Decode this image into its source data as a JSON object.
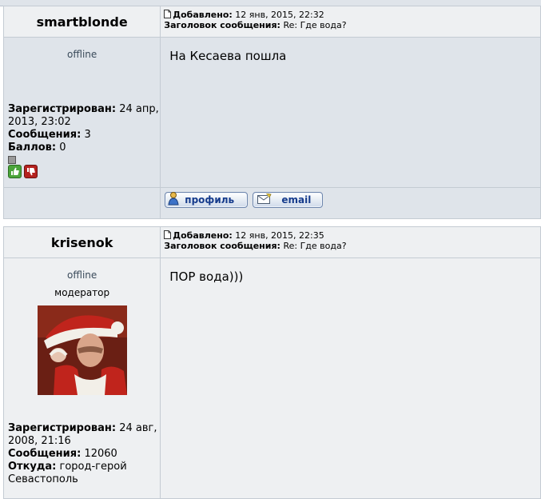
{
  "posts": [
    {
      "username": "smartblonde",
      "status": "offline",
      "added_label": "Добавлено:",
      "added_date": "12 янв, 2015, 22:32",
      "subject_label": "Заголовок сообщения:",
      "subject": "Re: Где вода?",
      "body": "На Кесаева пошла",
      "registered_label": "Зарегистрирован:",
      "registered_line1": "24 апр,",
      "registered_line2": "2013, 23:02",
      "messages_label": "Сообщения:",
      "messages": "3",
      "points_label": "Баллов:",
      "points": "0",
      "profile_button": "профиль",
      "email_button": "email"
    },
    {
      "username": "krisenok",
      "status": "offline",
      "rank": "модератор",
      "added_label": "Добавлено:",
      "added_date": "12 янв, 2015, 22:35",
      "subject_label": "Заголовок сообщения:",
      "subject": "Re: Где вода?",
      "body": "ПОР вода)))",
      "registered_label": "Зарегистрирован:",
      "registered_line1": "24 авг,",
      "registered_line2": "2008, 21:16",
      "messages_label": "Сообщения:",
      "messages": "12060",
      "from_label": "Откуда:",
      "from_line1": "город-герой",
      "from_line2": "Севастополь"
    }
  ],
  "colors": {
    "row_light": "#eef0f2",
    "row_dark": "#dfe4ea",
    "border": "#c4cbd3",
    "button_text": "#153b8c",
    "vote_up": "#4aa43a",
    "vote_down": "#b4221f"
  },
  "icons": [
    "post-icon",
    "thumbs-up-icon",
    "thumbs-down-icon",
    "profile-icon",
    "email-icon",
    "status-indicator-icon"
  ]
}
